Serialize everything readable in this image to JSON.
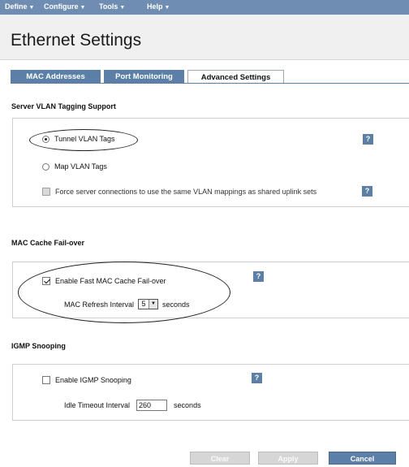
{
  "menu": [
    {
      "label": "Define"
    },
    {
      "label": "Configure"
    },
    {
      "label": "Tools"
    },
    {
      "label": "Help"
    }
  ],
  "page": {
    "title": "Ethernet Settings"
  },
  "tabs": [
    {
      "label": "MAC Addresses",
      "active": false
    },
    {
      "label": "Port Monitoring",
      "active": false
    },
    {
      "label": "Advanced Settings",
      "active": true
    }
  ],
  "vlan": {
    "heading": "Server VLAN Tagging Support",
    "tunnel_label": "Tunnel VLAN Tags",
    "tunnel_selected": true,
    "map_label": "Map VLAN Tags",
    "map_selected": false,
    "force_label": "Force server connections to use the same VLAN mappings as shared uplink sets",
    "force_checked": false,
    "force_enabled": false
  },
  "mac_cache": {
    "heading": "MAC Cache Fail-over",
    "enable_label": "Enable Fast MAC Cache Fail-over",
    "enable_checked": true,
    "interval_label": "MAC Refresh Interval",
    "interval_value": "5",
    "interval_unit": "seconds"
  },
  "igmp": {
    "heading": "IGMP Snooping",
    "enable_label": "Enable IGMP Snooping",
    "enable_checked": false,
    "timeout_label": "Idle Timeout Interval",
    "timeout_value": "260",
    "timeout_unit": "seconds"
  },
  "help_glyph": "?",
  "buttons": {
    "clear": "Clear",
    "apply": "Apply",
    "cancel": "Cancel"
  },
  "colors": {
    "menubar": "#6f8db2",
    "accent": "#5c7fa8",
    "disabled": "#d6d6d6"
  }
}
